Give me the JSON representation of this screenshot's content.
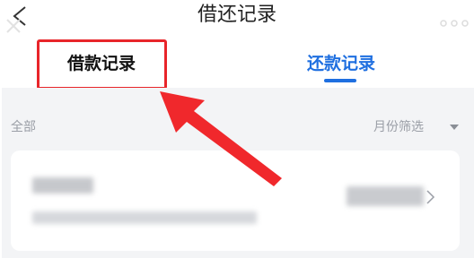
{
  "header": {
    "title": "借还记录",
    "back_icon": "back-arrow-icon",
    "more_icon": "more-dots-icon"
  },
  "tabs": [
    {
      "label": "借款记录",
      "active": false
    },
    {
      "label": "还款记录",
      "active": true
    }
  ],
  "filter": {
    "all_label": "全部",
    "month_filter_label": "月份筛选"
  },
  "records": [
    {
      "note": "blurred record entry"
    }
  ],
  "colors": {
    "accent": "#1f6fe0",
    "highlight": "#e8252a",
    "background": "#f3f4f6",
    "muted_text": "#9a9ea6"
  }
}
